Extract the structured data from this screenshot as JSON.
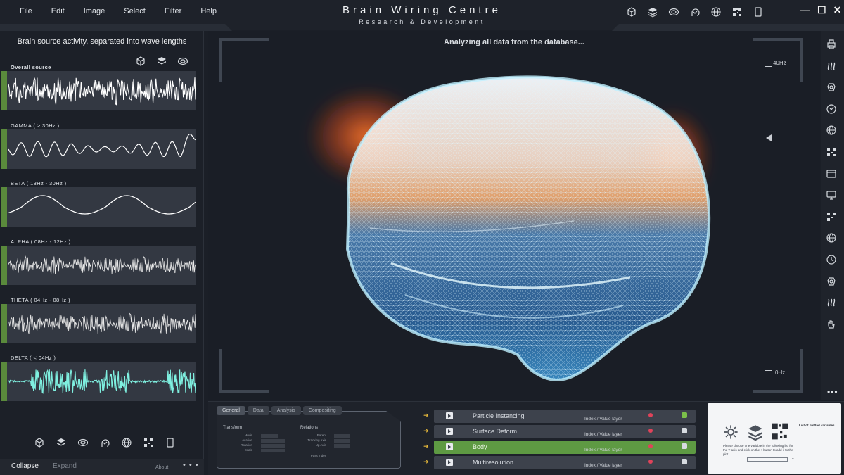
{
  "menu": [
    "File",
    "Edit",
    "Image",
    "Select",
    "Filter",
    "Help"
  ],
  "app": {
    "title": "Brain Wiring Centre",
    "subtitle": "Research & Development"
  },
  "top_icons": [
    "cube-icon",
    "layers-icon",
    "brain-icon",
    "head-icon",
    "globe-icon",
    "qr-icon",
    "tablet-icon"
  ],
  "window_controls": {
    "minimize": "—",
    "maximize": "☐",
    "close": "✕"
  },
  "left_panel": {
    "title": "Brain source activity, separated into wave lengths",
    "waves": [
      {
        "label": "Overall source"
      },
      {
        "label": "GAMMA ( > 30Hz )"
      },
      {
        "label": "BETA ( 13Hz - 30Hz )"
      },
      {
        "label": "ALPHA ( 08Hz - 12Hz )"
      },
      {
        "label": "THETA ( 04Hz - 08Hz )"
      },
      {
        "label": "DELTA ( < 04Hz )"
      }
    ],
    "collapse_label": "Collapse",
    "expand_label": "Expand",
    "about_label": "About",
    "more_label": "• • •"
  },
  "viewport": {
    "status": "Analyzing all data from the database...",
    "scale_max": "40Hz",
    "scale_min": "0Hz"
  },
  "right_toolbar": {
    "icons": [
      "printer-icon",
      "waves-icon",
      "brain-icon",
      "head-icon",
      "globe-icon",
      "qr-icon",
      "window-icon",
      "monitor-icon",
      "qr-icon",
      "globe-icon",
      "head-icon",
      "brain-icon",
      "waves-icon",
      "hand-icon"
    ],
    "more_label": "•••"
  },
  "bottom_panel": {
    "tabs": [
      "General",
      "Data",
      "Analysis",
      "Compositing"
    ],
    "transform_label": "Transform",
    "relations_label": "Relations",
    "transform_rows": [
      "Mode",
      "Location",
      "Rotation",
      "Scale"
    ],
    "relations_rows": [
      "Parent",
      "Tracking Axis",
      "Up Axis",
      "Pass Index"
    ],
    "layers": [
      {
        "name": "Particle Instancing",
        "sub": "Index / Value layer",
        "active": false,
        "checked": true
      },
      {
        "name": "Surface Deform",
        "sub": "Index / Value layer",
        "active": false,
        "checked": false
      },
      {
        "name": "Body",
        "sub": "Index / Value layer",
        "active": true,
        "checked": false
      },
      {
        "name": "Multiresolution",
        "sub": "Index / Value layer",
        "active": false,
        "checked": false
      }
    ],
    "preview": {
      "title": "List of plotted variables",
      "instruction": "Please choose one variable in the following list for the Y axis and click on the + button to add it to the plot",
      "add_label": "+"
    }
  },
  "colors": {
    "accent_green": "#5e9a43",
    "warning_red": "#e0435a",
    "arrow_yellow": "#e0b43a",
    "wave_glow": "#7ff0e0"
  }
}
